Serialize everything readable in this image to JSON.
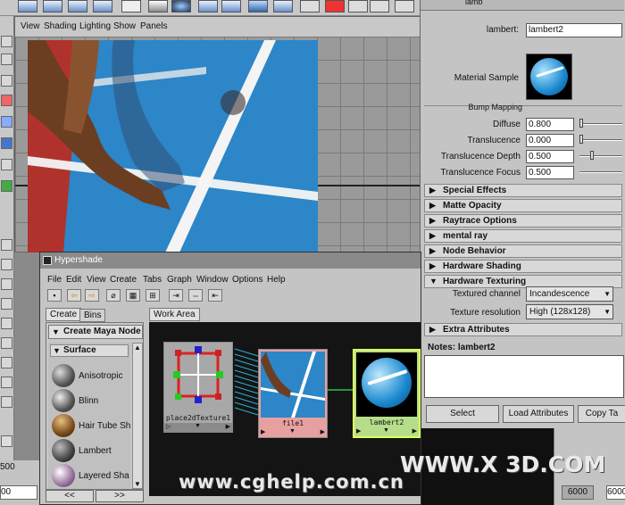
{
  "viewport": {
    "menu": [
      "View",
      "Shading",
      "Lighting",
      "Show",
      "Panels"
    ]
  },
  "attribute_editor": {
    "top_tab": "lamb",
    "material_label": "lambert:",
    "material_name": "lambert2",
    "sample_label": "Material Sample",
    "bump_label": "Bump Mapping",
    "attrs": [
      {
        "label": "Diffuse",
        "value": "0.800",
        "level": 0.8
      },
      {
        "label": "Translucence",
        "value": "0.000",
        "level": 0.0
      },
      {
        "label": "Translucence Depth",
        "value": "0.500",
        "level": 0.5
      },
      {
        "label": "Translucence Focus",
        "value": "0.500",
        "level": 0.5
      }
    ],
    "sections": [
      "Special Effects",
      "Matte Opacity",
      "Raytrace Options",
      "mental ray",
      "Node Behavior",
      "Hardware Shading",
      "Hardware Texturing",
      "Extra Attributes"
    ],
    "textured_channel_label": "Textured channel",
    "textured_channel_value": "Incandescence",
    "texture_resolution_label": "Texture resolution",
    "texture_resolution_value": "High  (128x128)",
    "notes_label": "Notes: lambert2",
    "buttons": {
      "select": "Select",
      "load": "Load Attributes",
      "copy": "Copy Ta"
    }
  },
  "hypershade": {
    "title": "Hypershade",
    "menu": [
      "File",
      "Edit",
      "View",
      "Create",
      "Tabs",
      "Graph",
      "Window",
      "Options",
      "Help"
    ],
    "tabs": {
      "create": "Create",
      "bins": "Bins",
      "work_area": "Work Area"
    },
    "create_header": "Create Maya Node",
    "surface_header": "Surface",
    "shaders": [
      "Anisotropic",
      "Blinn",
      "Hair Tube Sh",
      "Lambert",
      "Layered Sha"
    ],
    "nav": {
      "left": "<<",
      "right": ">>"
    },
    "nodes": {
      "place": "place2dTexture1",
      "file": "file1",
      "lambert": "lambert2"
    }
  },
  "status": {
    "left_val_1": "500",
    "left_val_2": "00",
    "right_val_1": "6000",
    "right_val_2": "6000"
  },
  "watermarks": {
    "site1": "www.cghelp.com.cn",
    "site2": "WWW.X 3D.COM"
  }
}
